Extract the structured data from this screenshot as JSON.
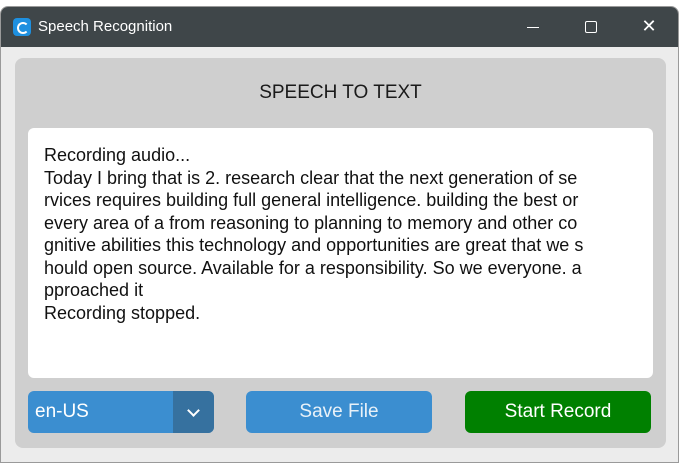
{
  "window": {
    "title": "Speech Recognition",
    "app_icon": "app-c-icon"
  },
  "panel": {
    "heading": "SPEECH TO TEXT",
    "transcript_lines": [
      "Recording audio...",
      "Today I bring that is 2. research clear that the next generation of se",
      "rvices requires building full general intelligence. building the best or",
      "every area of a from reasoning to planning to memory and other co",
      "gnitive abilities this technology and opportunities are great that we s",
      "hould open source. Available for a responsibility. So we everyone. a",
      "pproached it",
      "Recording stopped."
    ]
  },
  "controls": {
    "language_selected": "en-US",
    "save_label": "Save File",
    "record_label": "Start Record"
  },
  "colors": {
    "titlebar": "#3f4649",
    "panel": "#cfcfcf",
    "accent": "#3b8ed0",
    "dropdown_arrow_bg": "#36719f",
    "record": "#008000"
  }
}
